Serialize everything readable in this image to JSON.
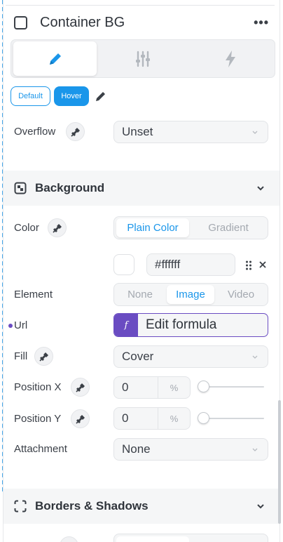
{
  "header": {
    "title": "Container BG",
    "more_label": "•••"
  },
  "mode_tabs": [
    {
      "icon": "pencil-icon",
      "active": true
    },
    {
      "icon": "sliders-icon",
      "active": false
    },
    {
      "icon": "lightning-icon",
      "active": false
    }
  ],
  "states": {
    "default_label": "Default",
    "hover_label": "Hover"
  },
  "overflow": {
    "label": "Overflow",
    "value": "Unset"
  },
  "background_section": {
    "title": "Background",
    "color": {
      "label": "Color",
      "options": [
        "Plain Color",
        "Gradient"
      ],
      "selected": "Plain Color",
      "swatch": "#ffffff",
      "hex": "#ffffff"
    },
    "element": {
      "label": "Element",
      "options": [
        "None",
        "Image",
        "Video"
      ],
      "selected": "Image"
    },
    "url": {
      "label": "Url",
      "formula_badge": "f",
      "formula_label": "Edit formula"
    },
    "fill": {
      "label": "Fill",
      "value": "Cover"
    },
    "position_x": {
      "label": "Position X",
      "value": "0",
      "unit": "%",
      "slider": 0
    },
    "position_y": {
      "label": "Position Y",
      "value": "0",
      "unit": "%",
      "slider": 0
    },
    "attachment": {
      "label": "Attachment",
      "value": "None"
    }
  },
  "borders_section": {
    "title": "Borders & Shadows"
  },
  "colors": {
    "accent": "#1a96ea",
    "formula": "#6a4cc2",
    "guide": "#46a6e8"
  }
}
